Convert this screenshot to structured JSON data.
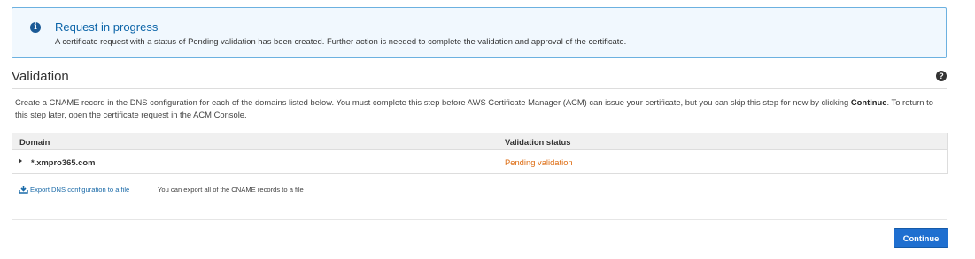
{
  "alert": {
    "icon": "info-icon",
    "title": "Request in progress",
    "message": "A certificate request with a status of Pending validation has been created. Further action is needed to complete the validation and approval of the certificate."
  },
  "section": {
    "title": "Validation",
    "help_icon": "help-icon",
    "description_pre": "Create a CNAME record in the DNS configuration for each of the domains listed below. You must complete this step before AWS Certificate Manager (ACM) can issue your certificate, but you can skip this step for now by clicking ",
    "description_bold": "Continue",
    "description_post": ". To return to this step later, open the certificate request in the ACM Console."
  },
  "table": {
    "columns": [
      "Domain",
      "Validation status"
    ],
    "rows": [
      {
        "domain": "*.xmpro365.com",
        "status": "Pending validation",
        "status_color": "#dd6b10"
      }
    ]
  },
  "export": {
    "link_label": "Export DNS configuration to a file",
    "note": "You can export all of the CNAME records to a file"
  },
  "footer": {
    "continue_label": "Continue"
  }
}
